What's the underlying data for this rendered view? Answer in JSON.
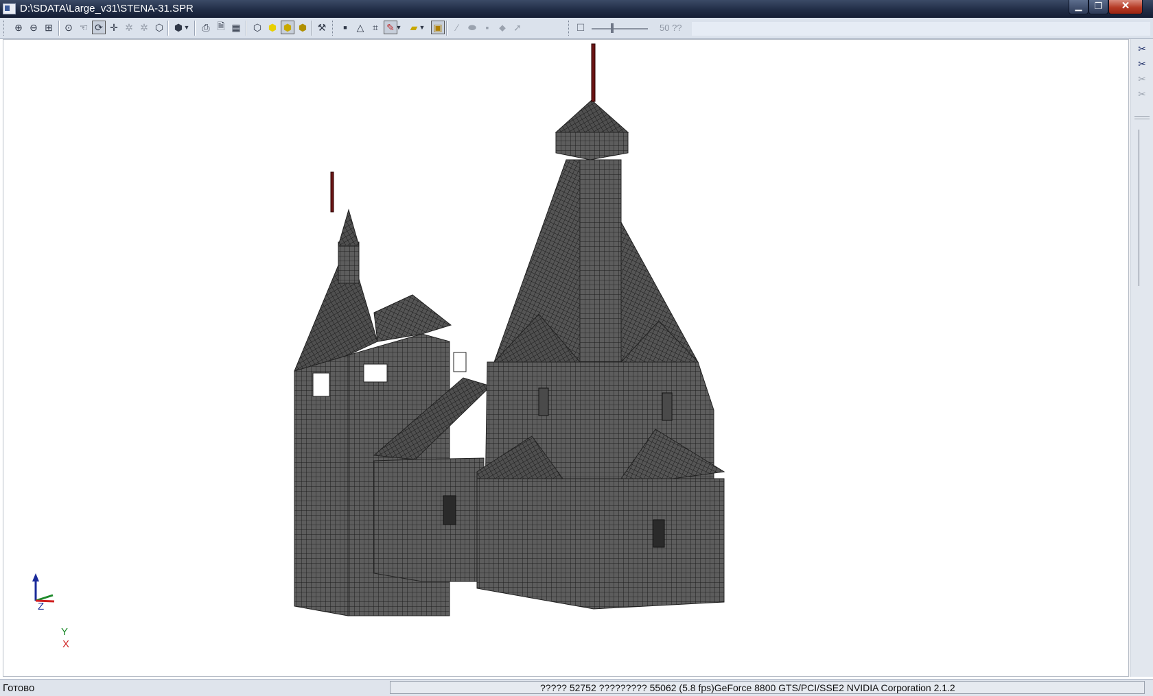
{
  "window": {
    "title": "D:\\SDATA\\Large_v31\\STENA-31.SPR",
    "min_icon": "minimize-icon",
    "max_icon": "restore-icon",
    "close_icon": "close-icon"
  },
  "toolbar": {
    "zoom_value": "50 ??",
    "icons": [
      "zoom-in-icon",
      "zoom-out-icon",
      "zoom-window-icon",
      "zoom-all-icon",
      "pan-icon",
      "rotate-icon",
      "center-icon",
      "select-icon",
      "select-off-icon",
      "box-view-icon",
      "view-dropdown-icon",
      "print-icon",
      "preview-icon",
      "report-icon",
      "wireframe-icon",
      "solid-yellow-icon",
      "solid-shaded-icon",
      "solid-cube-icon",
      "tools-icon",
      "node-icon",
      "triangle-icon",
      "grid-icon",
      "brush-icon",
      "fill-icon",
      "screen-icon",
      "pen-icon",
      "eraser-icon",
      "box-icon",
      "pencil-icon",
      "arrow-icon",
      "checkbox-icon",
      "slider-icon"
    ],
    "active_color": "#c7cfdb"
  },
  "right_panel": {
    "icons": [
      "scissors-icon",
      "scissors-icon",
      "scissors-gray-icon",
      "scissors-gray-icon"
    ]
  },
  "axes": {
    "z": "Z",
    "y": "Y",
    "x": "X",
    "z_color": "#1a2a9a",
    "y_color": "#1d8a2a",
    "x_color": "#d02020"
  },
  "model": {
    "fill_color": "#5d5d5d",
    "mesh_color": "#1e1e1e",
    "spire_color": "#6b1414"
  },
  "status": {
    "ready": "Готово",
    "info": "????? 52752  ????????? 55062  (5.8 fps)GeForce 8800 GTS/PCI/SSE2 NVIDIA Corporation 2.1.2"
  }
}
